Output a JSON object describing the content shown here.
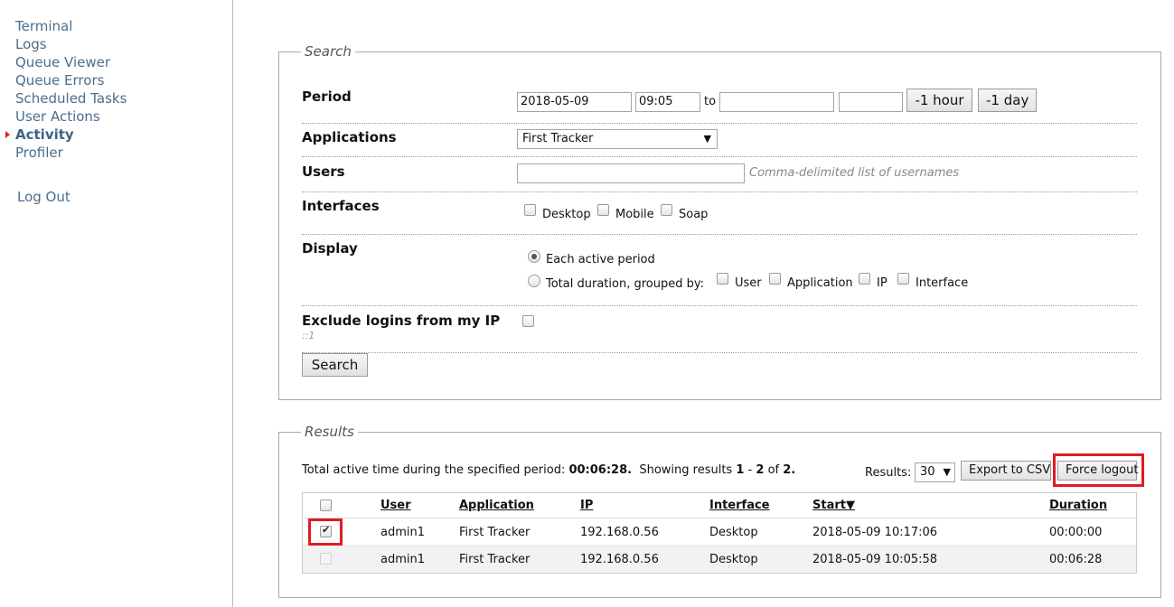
{
  "sidebar": {
    "items": [
      {
        "label": "Terminal"
      },
      {
        "label": "Logs"
      },
      {
        "label": "Queue Viewer"
      },
      {
        "label": "Queue Errors"
      },
      {
        "label": "Scheduled Tasks"
      },
      {
        "label": "User Actions"
      },
      {
        "label": "Activity",
        "active": true
      },
      {
        "label": "Profiler"
      }
    ],
    "logout": "Log Out"
  },
  "search": {
    "legend": "Search",
    "period": {
      "label": "Period",
      "from_date": "2018-05-09",
      "from_time": "09:05",
      "to_label": "to",
      "to_date": "",
      "to_time": "",
      "minus_hour": "-1 hour",
      "minus_day": "-1 day"
    },
    "applications": {
      "label": "Applications",
      "selected": "First Tracker"
    },
    "users": {
      "label": "Users",
      "value": "",
      "hint": "Comma-delimited list of usernames"
    },
    "interfaces": {
      "label": "Interfaces",
      "options": [
        "Desktop",
        "Mobile",
        "Soap"
      ]
    },
    "display": {
      "label": "Display",
      "each_active": "Each active period",
      "total_duration": "Total duration, grouped by:",
      "group_options": [
        "User",
        "Application",
        "IP",
        "Interface"
      ]
    },
    "exclude": {
      "label": "Exclude logins from my IP",
      "ip": "::1"
    },
    "search_button": "Search"
  },
  "results": {
    "legend": "Results",
    "summary_prefix": "Total active time during the specified period:",
    "total_time": "00:06:28.",
    "showing_prefix": "Showing results",
    "range_from": "1",
    "dash": "-",
    "range_to": "2",
    "of": "of",
    "total": "2.",
    "per_page_label": "Results:",
    "per_page": "30",
    "export_button": "Export to CSV",
    "force_logout_button": "Force logout",
    "columns": [
      "User",
      "Application",
      "IP",
      "Interface",
      "Start▼",
      "Duration"
    ],
    "rows": [
      {
        "checked": true,
        "user": "admin1",
        "application": "First Tracker",
        "ip": "192.168.0.56",
        "interface": "Desktop",
        "start": "2018-05-09 10:17:06",
        "duration": "00:00:00"
      },
      {
        "checked": false,
        "user": "admin1",
        "application": "First Tracker",
        "ip": "192.168.0.56",
        "interface": "Desktop",
        "start": "2018-05-09 10:05:58",
        "duration": "00:06:28"
      }
    ]
  }
}
